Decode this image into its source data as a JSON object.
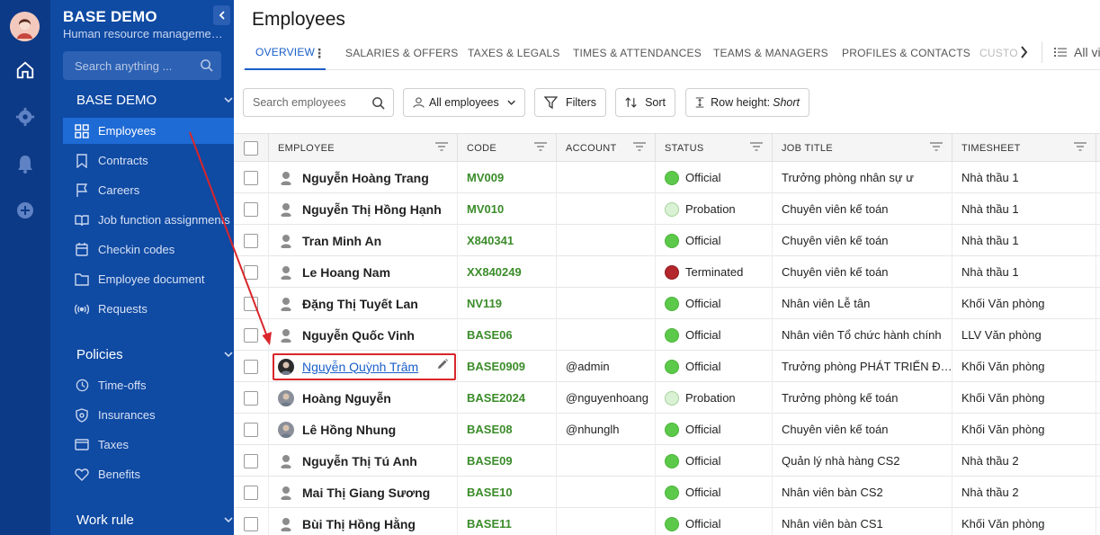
{
  "sidebar": {
    "title": "BASE DEMO",
    "subtitle": "Human resource manageme…",
    "search_placeholder": "Search anything ...",
    "section_base": "BASE DEMO",
    "items_base": [
      {
        "label": "Employees",
        "icon": "grid-icon"
      },
      {
        "label": "Contracts",
        "icon": "bookmark-icon"
      },
      {
        "label": "Careers",
        "icon": "flag-icon"
      },
      {
        "label": "Job function assignments",
        "icon": "book-icon"
      },
      {
        "label": "Checkin codes",
        "icon": "calendar-icon"
      },
      {
        "label": "Employee document",
        "icon": "document-icon"
      },
      {
        "label": "Requests",
        "icon": "broadcast-icon"
      }
    ],
    "section_policies": "Policies",
    "items_policies": [
      {
        "label": "Time-offs",
        "icon": "clock-icon"
      },
      {
        "label": "Insurances",
        "icon": "shield-icon"
      },
      {
        "label": "Taxes",
        "icon": "card-icon"
      },
      {
        "label": "Benefits",
        "icon": "heart-icon"
      }
    ],
    "section_work": "Work rule"
  },
  "header": {
    "title": "Employees"
  },
  "tabs": [
    "OVERVIEW",
    "SALARIES & OFFERS",
    "TAXES & LEGALS",
    "TIMES & ATTENDANCES",
    "TEAMS & MANAGERS",
    "PROFILES & CONTACTS",
    "CUSTO"
  ],
  "all_views": "All vi",
  "toolbar": {
    "search_placeholder": "Search employees",
    "all_employees": "All employees",
    "filters": "Filters",
    "sort": "Sort",
    "row_height_label": "Row height:",
    "row_height_value": "Short"
  },
  "table": {
    "headers": [
      "EMPLOYEE",
      "CODE",
      "ACCOUNT",
      "STATUS",
      "JOB TITLE",
      "TIMESHEET"
    ],
    "rows": [
      {
        "name": "Nguyễn Hoàng Trang",
        "code": "MV009",
        "account": "",
        "status": "Official",
        "job": "Trưởng phòng nhân sự ư",
        "timesheet": "Nhà thầu 1"
      },
      {
        "name": "Nguyễn Thị Hồng Hạnh",
        "code": "MV010",
        "account": "",
        "status": "Probation",
        "job": "Chuyên viên kế toán",
        "timesheet": "Nhà thầu 1"
      },
      {
        "name": "Tran Minh An",
        "code": "X840341",
        "account": "",
        "status": "Official",
        "job": "Chuyên viên kế toán",
        "timesheet": "Nhà thầu 1"
      },
      {
        "name": "Le Hoang Nam",
        "code": "XX840249",
        "account": "",
        "status": "Terminated",
        "job": "Chuyên viên kế toán",
        "timesheet": "Nhà thầu 1"
      },
      {
        "name": "Đặng Thị Tuyết Lan",
        "code": "NV119",
        "account": "",
        "status": "Official",
        "job": "Nhân viên Lễ tân",
        "timesheet": "Khối Văn phòng"
      },
      {
        "name": "Nguyễn Quốc Vinh",
        "code": "BASE06",
        "account": "",
        "status": "Official",
        "job": "Nhân viên Tổ chức hành chính",
        "timesheet": "LLV Văn phòng"
      },
      {
        "name": "Nguyễn Quỳnh Trâm",
        "code": "BASE0909",
        "account": "@admin",
        "status": "Official",
        "job": "Trưởng phòng PHÁT TRIỂN Đ…",
        "timesheet": "Khối Văn phòng"
      },
      {
        "name": "Hoàng Nguyễn",
        "code": "BASE2024",
        "account": "@nguyenhoang",
        "status": "Probation",
        "job": "Trưởng phòng kế toán",
        "timesheet": "Khối Văn phòng"
      },
      {
        "name": "Lê Hồng Nhung",
        "code": "BASE08",
        "account": "@nhunglh",
        "status": "Official",
        "job": "Chuyên viên kế toán",
        "timesheet": "Khối Văn phòng"
      },
      {
        "name": "Nguyễn Thị Tú Anh",
        "code": "BASE09",
        "account": "",
        "status": "Official",
        "job": "Quản lý nhà hàng CS2",
        "timesheet": "Nhà thầu 2"
      },
      {
        "name": "Mai Thị Giang Sương",
        "code": "BASE10",
        "account": "",
        "status": "Official",
        "job": "Nhân viên bàn CS2",
        "timesheet": "Nhà thầu 2"
      },
      {
        "name": "Bùi Thị Hồng Hằng",
        "code": "BASE11",
        "account": "",
        "status": "Official",
        "job": "Nhân viên bàn CS1",
        "timesheet": "Khối Văn phòng"
      }
    ]
  },
  "colors": {
    "rail": "#0d3a86",
    "sidebar": "#0f4aa3",
    "active": "#1e6bd6",
    "code_green": "#3b8c2a",
    "official": "#5cc94a",
    "probation": "#d9f2d4",
    "terminated": "#b3262b",
    "highlight": "#d9262b"
  }
}
